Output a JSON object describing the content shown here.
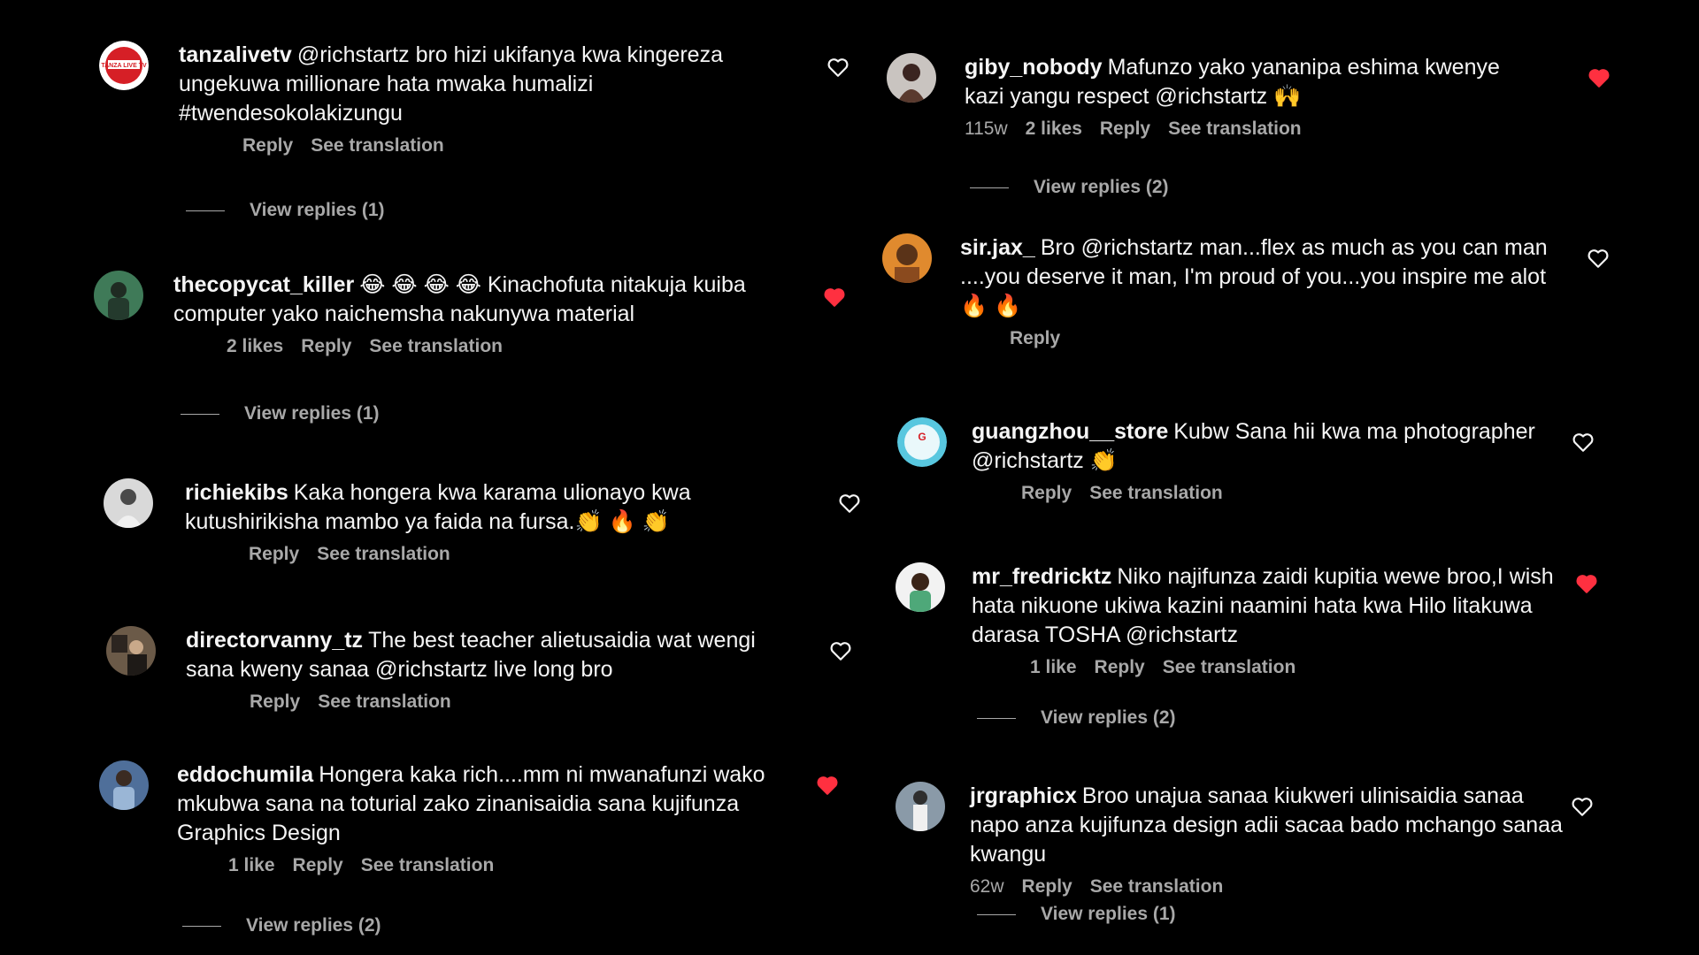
{
  "comments": [
    {
      "user": "tanzalivetv",
      "text": "@richstartz bro hizi ukifanya kwa kingereza ungekuwa millionare hata mwaka humalizi #twendesokolakizungu",
      "likes": "",
      "time": "",
      "reply": "Reply",
      "translation": "See translation",
      "view_replies": "View replies (1)",
      "liked": false,
      "avatar_color": "#ffffff",
      "avatar_text": "TANZA LIVE TV"
    },
    {
      "user": "thecopycat_killer",
      "text": "😂 😂 😂 😂 Kinachofuta nitakuja kuiba computer yako naichemsha nakunywa material",
      "likes": "2 likes",
      "time": "",
      "reply": "Reply",
      "translation": "See translation",
      "view_replies": "View replies (1)",
      "liked": true,
      "avatar_color": "#3f7a58"
    },
    {
      "user": "richiekibs",
      "text": "Kaka hongera kwa karama ulionayo kwa kutushirikisha mambo ya faida na fursa.👏 🔥 👏",
      "likes": "",
      "time": "",
      "reply": "Reply",
      "translation": "See translation",
      "view_replies": "",
      "liked": false,
      "avatar_color": "#d9d9d9"
    },
    {
      "user": "directorvanny_tz",
      "text": "The best teacher alietusaidia wat wengi sana kweny sanaa @richstartz live long bro",
      "likes": "",
      "time": "",
      "reply": "Reply",
      "translation": "See translation",
      "view_replies": "",
      "liked": false,
      "avatar_color": "#6b5a48"
    },
    {
      "user": "eddochumila",
      "text": "Hongera kaka rich....mm ni mwanafunzi wako mkubwa sana na toturial zako zinanisaidia sana kujifunza Graphics Design",
      "likes": "1 like",
      "time": "",
      "reply": "Reply",
      "translation": "See translation",
      "view_replies": "View replies (2)",
      "liked": true,
      "avatar_color": "#4f6f9a"
    },
    {
      "user": "giby_nobody",
      "text": "Mafunzo yako yananipa eshima kwenye kazi yangu respect @richstartz 🙌",
      "likes": "2 likes",
      "time": "115w",
      "reply": "Reply",
      "translation": "See translation",
      "view_replies": "View replies (2)",
      "liked": true,
      "avatar_color": "#c9c4c0"
    },
    {
      "user": "sir.jax_",
      "text": "Bro @richstartz man...flex as much as you can man ....you deserve it man, I'm proud of you...you inspire me alot🔥 🔥",
      "likes": "",
      "time": "",
      "reply": "Reply",
      "translation": "",
      "view_replies": "",
      "liked": false,
      "avatar_color": "#e08a2e"
    },
    {
      "user": "guangzhou__store",
      "text": "Kubw Sana hii kwa ma photographer @richstartz 👏",
      "likes": "",
      "time": "",
      "reply": "Reply",
      "translation": "See translation",
      "view_replies": "",
      "liked": false,
      "avatar_color": "#58c7df"
    },
    {
      "user": "mr_fredricktz",
      "text": "Niko najifunza zaidi kupitia wewe broo,I wish hata nikuone ukiwa kazini naamini hata kwa Hilo litakuwa darasa TOSHA @richstartz",
      "likes": "1 like",
      "time": "",
      "reply": "Reply",
      "translation": "See translation",
      "view_replies": "View replies (2)",
      "liked": true,
      "avatar_color": "#4ea879"
    },
    {
      "user": "jrgraphicx",
      "text": "Broo unajua sanaa kiukweri ulinisaidia sanaa napo anza kujifunza design adii sacaa bado mchango sanaa kwangu",
      "likes": "",
      "time": "62w",
      "reply": "Reply",
      "translation": "See translation",
      "view_replies": "View replies (1)",
      "liked": false,
      "avatar_color": "#8a9aa8"
    }
  ],
  "colors": {
    "liked_heart": "#ff3040",
    "text_secondary": "#a8a8a8"
  }
}
